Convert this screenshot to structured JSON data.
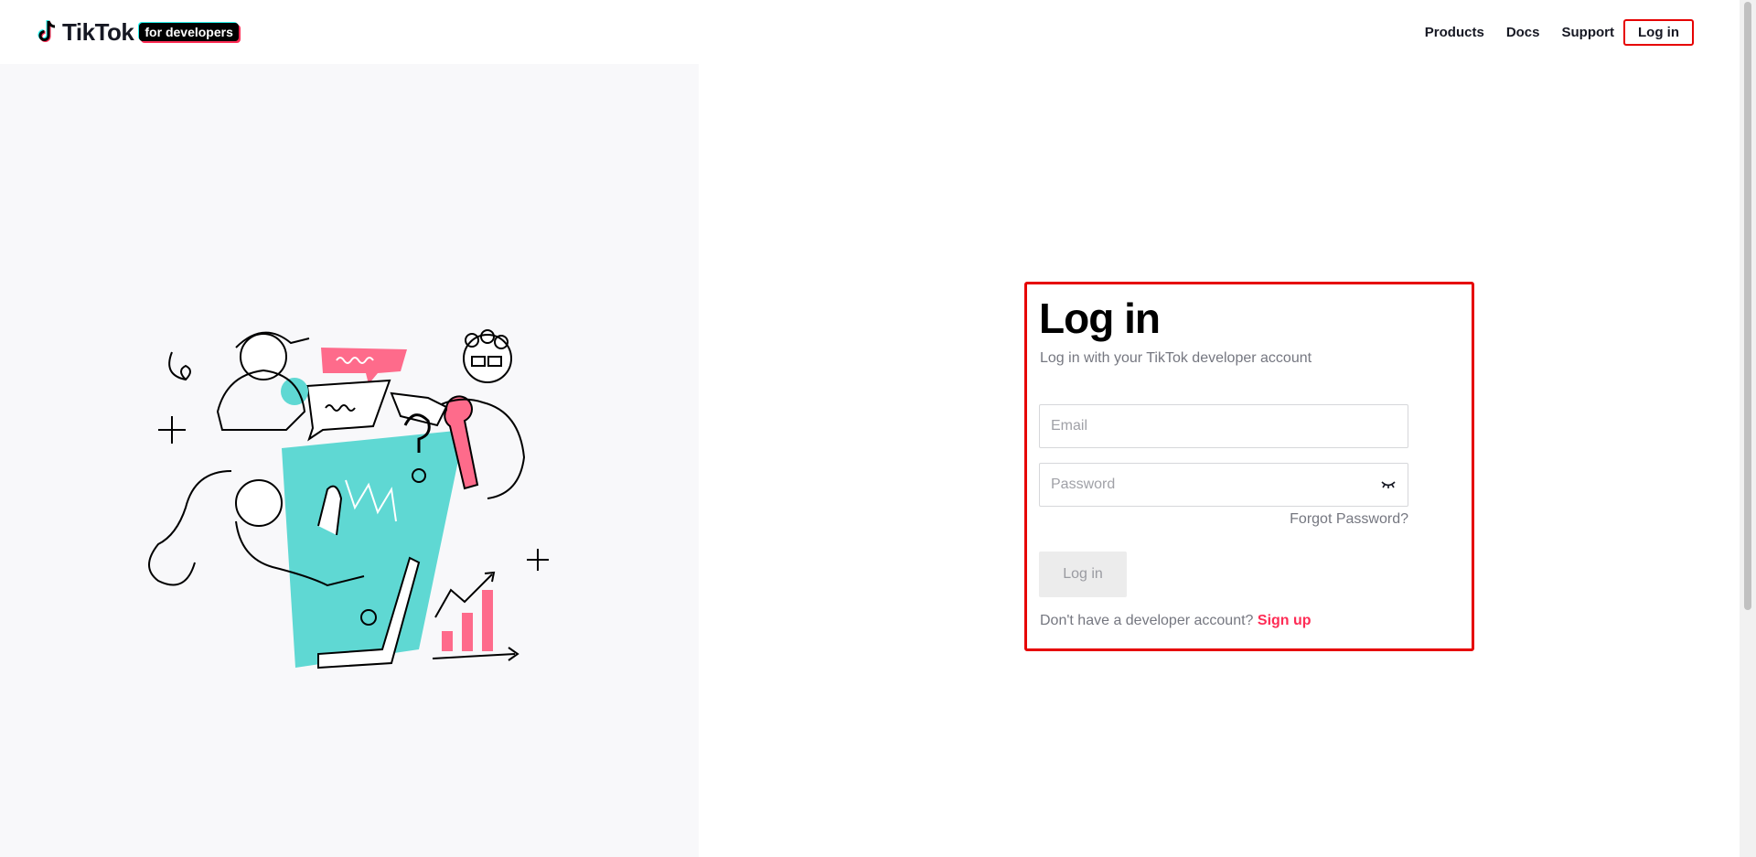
{
  "header": {
    "logo_text": "TikTok",
    "logo_badge": "for developers",
    "nav": [
      {
        "label": "Products"
      },
      {
        "label": "Docs"
      },
      {
        "label": "Support"
      }
    ],
    "login_label": "Log in"
  },
  "login": {
    "title": "Log in",
    "subtitle": "Log in with your TikTok developer account",
    "email_placeholder": "Email",
    "password_placeholder": "Password",
    "forgot_label": "Forgot Password?",
    "button_label": "Log in",
    "signup_prompt": "Don't have a developer account?",
    "signup_link": "Sign up"
  },
  "colors": {
    "accent": "#fe2c55",
    "teal": "#5fd8d3",
    "highlight_border": "#e60000"
  }
}
